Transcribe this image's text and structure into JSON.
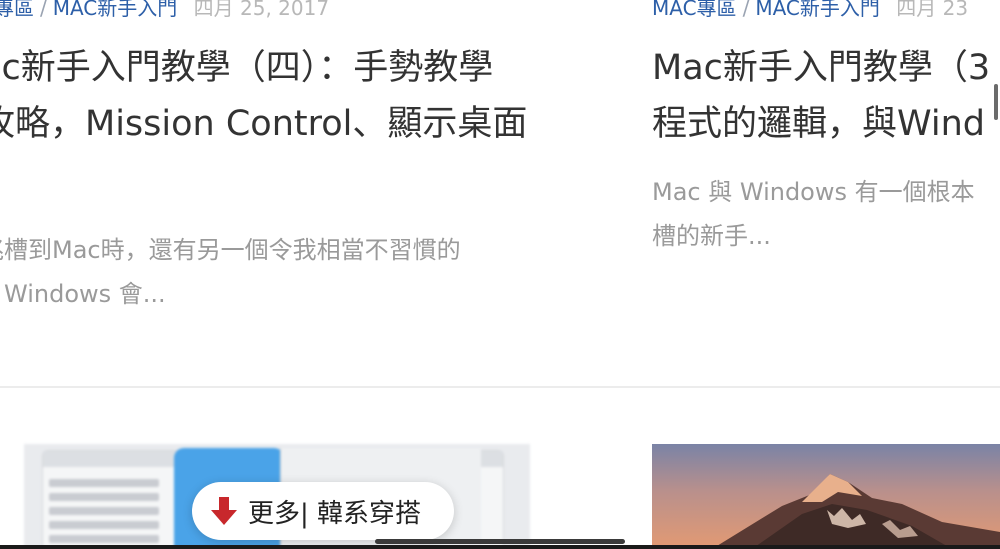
{
  "cards": [
    {
      "category1": "C專區",
      "separator": "/",
      "category2": "MAC新手入門",
      "date": "四月 25, 2017",
      "title_line1": "ac新手入門教學（四）：手勢教學",
      "title_line2": "攻略，Mission Control、顯示桌面",
      "excerpt_line1": "兆槽到Mac時，還有另一個令我相當不習慣的",
      "excerpt_line2": "，Windows 會..."
    },
    {
      "category1": "MAC專區",
      "separator": "/",
      "category2": "MAC新手入門",
      "date": "四月 23",
      "title_line1": "Mac新手入門教學（3",
      "title_line2": "程式的邏輯，與Wind",
      "excerpt_line1": "Mac 與 Windows 有一個根本",
      "excerpt_line2": "槽的新手..."
    }
  ],
  "more_button": {
    "label": "更多| 韓系穿搭",
    "icon": "down-arrow-icon",
    "icon_color": "#c8282c"
  },
  "colors": {
    "category": "#2d5fa8",
    "date": "#b8b8b8",
    "title": "#333333",
    "excerpt": "#9a9a9a"
  }
}
